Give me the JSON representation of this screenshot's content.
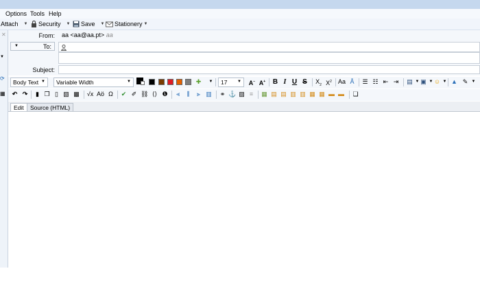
{
  "menu": {
    "items": [
      "Options",
      "Tools",
      "Help"
    ]
  },
  "toolbar": {
    "attach": "Attach",
    "security": "Security",
    "save": "Save",
    "stationery": "Stationery"
  },
  "header": {
    "from_label": "From:",
    "from_value": "aa <aa@aa.pt>",
    "from_suffix": "aa",
    "to_label": "To:",
    "subject_label": "Subject:",
    "subject_value": ""
  },
  "format": {
    "paragraph_style": "Body Text",
    "font": "Variable Width",
    "font_size": "17",
    "colors": [
      "#000000",
      "#000000",
      "#7a3b00",
      "#e01b24",
      "#e66100",
      "#808080"
    ]
  },
  "tabs": [
    {
      "label": "Edit",
      "active": true
    },
    {
      "label": "Source (HTML)",
      "active": false
    }
  ]
}
